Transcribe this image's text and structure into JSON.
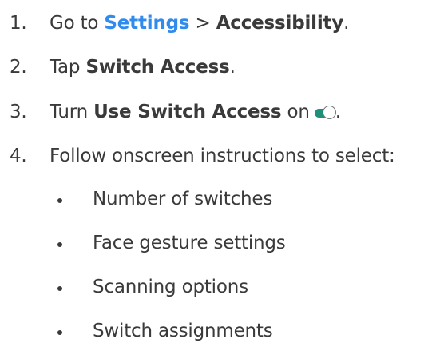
{
  "steps": [
    {
      "number": "1.",
      "prefix": "Go to ",
      "link": "Settings",
      "separator": " > ",
      "bold": "Accessibility",
      "suffix": "."
    },
    {
      "number": "2.",
      "prefix": "Tap ",
      "bold": "Switch Access",
      "suffix": "."
    },
    {
      "number": "3.",
      "prefix": "Turn ",
      "bold": "Use Switch Access",
      "middle": " on",
      "suffix": "."
    },
    {
      "number": "4.",
      "text": "Follow onscreen instructions to select:"
    }
  ],
  "options": [
    "Number of switches",
    "Face gesture settings",
    "Scanning options",
    "Switch assignments"
  ],
  "toggle": {
    "state": "on",
    "track_color": "#1f8f7a"
  },
  "colors": {
    "text": "#3a3a3a",
    "link": "#2f8bec"
  }
}
